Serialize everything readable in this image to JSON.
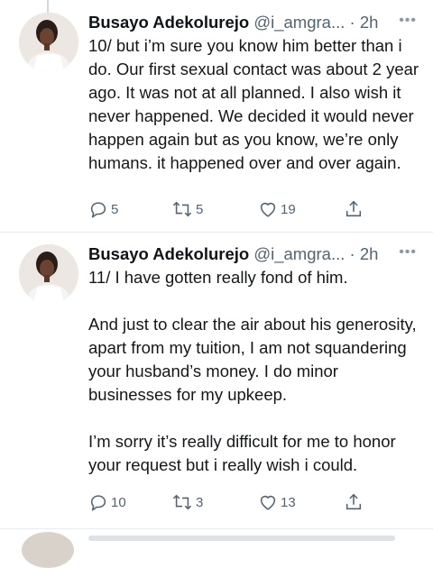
{
  "tweets": [
    {
      "author_name": "Busayo Adekolurejo",
      "author_handle": "@i_amgra...",
      "separator": " · ",
      "time": "2h",
      "more_label": "•••",
      "text": "10/ but i’m sure you know him better than i do. Our first sexual contact was about 2 year ago. It was not at all planned. I also wish it never happened. We decided it would never happen again but as you know, we’re only humans. it happened over and over again.",
      "replies": "5",
      "retweets": "5",
      "likes": "19"
    },
    {
      "author_name": "Busayo Adekolurejo",
      "author_handle": "@i_amgra...",
      "separator": " · ",
      "time": "2h",
      "more_label": "•••",
      "text": "11/ I have gotten really fond of him.\n\nAnd just to clear the air about his generosity, apart from my tuition, I am not squandering your husband’s money. I do minor businesses for my upkeep.\n\nI’m sorry it’s really difficult for me to honor your request but i really wish i could.",
      "replies": "10",
      "retweets": "3",
      "likes": "13"
    }
  ],
  "icons": {
    "reply": "reply-icon",
    "retweet": "retweet-icon",
    "like": "like-icon",
    "share": "share-icon"
  },
  "colors": {
    "text": "#0f1419",
    "secondary": "#536471",
    "divider": "#e6ecf0"
  }
}
